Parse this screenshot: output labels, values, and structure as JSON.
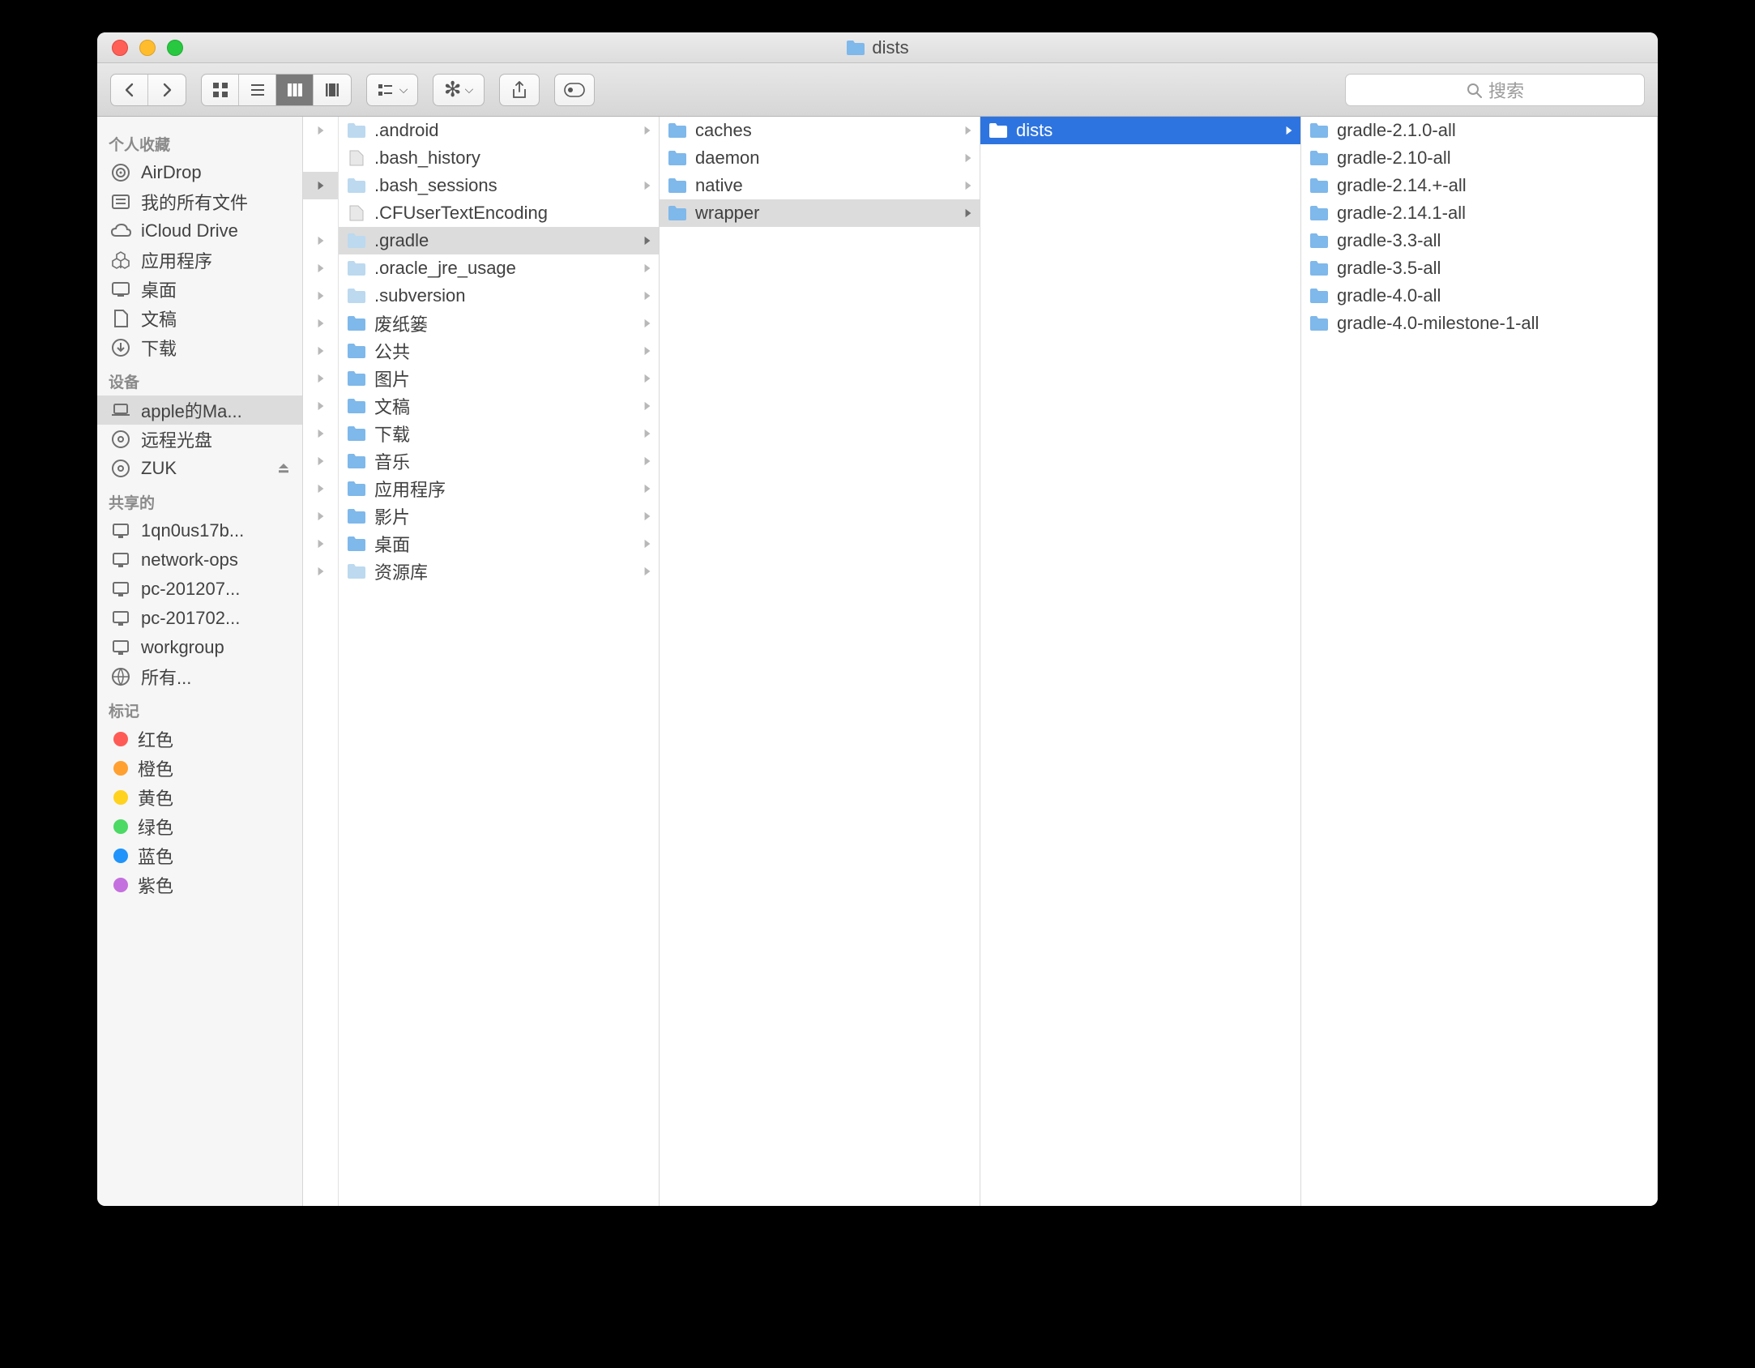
{
  "window": {
    "title": "dists"
  },
  "search": {
    "placeholder": "搜索"
  },
  "sidebar": {
    "sections": [
      {
        "heading": "个人收藏",
        "items": [
          {
            "icon": "airdrop",
            "label": "AirDrop"
          },
          {
            "icon": "allfiles",
            "label": "我的所有文件"
          },
          {
            "icon": "icloud",
            "label": "iCloud Drive"
          },
          {
            "icon": "apps",
            "label": "应用程序"
          },
          {
            "icon": "desktop",
            "label": "桌面"
          },
          {
            "icon": "docs",
            "label": "文稿"
          },
          {
            "icon": "downloads",
            "label": "下载"
          }
        ]
      },
      {
        "heading": "设备",
        "items": [
          {
            "icon": "laptop",
            "label": "apple的Ma...",
            "selected": true
          },
          {
            "icon": "disc",
            "label": "远程光盘"
          },
          {
            "icon": "disc",
            "label": "ZUK",
            "eject": true
          }
        ]
      },
      {
        "heading": "共享的",
        "items": [
          {
            "icon": "pc",
            "label": "1qn0us17b..."
          },
          {
            "icon": "pc",
            "label": "network-ops"
          },
          {
            "icon": "pc",
            "label": "pc-201207..."
          },
          {
            "icon": "pc",
            "label": "pc-201702..."
          },
          {
            "icon": "pc",
            "label": "workgroup"
          },
          {
            "icon": "globe",
            "label": "所有..."
          }
        ]
      },
      {
        "heading": "标记",
        "items": [
          {
            "tag": "#ff5b56",
            "label": "红色"
          },
          {
            "tag": "#ffa030",
            "label": "橙色"
          },
          {
            "tag": "#ffd21f",
            "label": "黄色"
          },
          {
            "tag": "#4cd964",
            "label": "绿色"
          },
          {
            "tag": "#2094fa",
            "label": "蓝色"
          },
          {
            "tag": "#c470de",
            "label": "紫色"
          }
        ]
      }
    ]
  },
  "columns": {
    "c0_selected_index": 2,
    "c1": [
      {
        "t": "folder-light",
        "label": ".android",
        "arrow": true
      },
      {
        "t": "file",
        "label": ".bash_history"
      },
      {
        "t": "folder-light",
        "label": ".bash_sessions",
        "arrow": true
      },
      {
        "t": "file",
        "label": ".CFUserTextEncoding"
      },
      {
        "t": "folder-light",
        "label": ".gradle",
        "arrow": true,
        "selected": "gray"
      },
      {
        "t": "folder-light",
        "label": ".oracle_jre_usage",
        "arrow": true
      },
      {
        "t": "folder-light",
        "label": ".subversion",
        "arrow": true
      },
      {
        "t": "folder",
        "label": "废纸篓",
        "arrow": true
      },
      {
        "t": "folder",
        "label": "公共",
        "arrow": true
      },
      {
        "t": "folder",
        "label": "图片",
        "arrow": true
      },
      {
        "t": "folder",
        "label": "文稿",
        "arrow": true
      },
      {
        "t": "folder",
        "label": "下载",
        "arrow": true
      },
      {
        "t": "folder",
        "label": "音乐",
        "arrow": true
      },
      {
        "t": "folder",
        "label": "应用程序",
        "arrow": true
      },
      {
        "t": "folder",
        "label": "影片",
        "arrow": true
      },
      {
        "t": "folder",
        "label": "桌面",
        "arrow": true
      },
      {
        "t": "folder-light",
        "label": "资源库",
        "arrow": true
      }
    ],
    "c2": [
      {
        "t": "folder",
        "label": "caches",
        "arrow": true
      },
      {
        "t": "folder",
        "label": "daemon",
        "arrow": true
      },
      {
        "t": "folder",
        "label": "native",
        "arrow": true
      },
      {
        "t": "folder",
        "label": "wrapper",
        "arrow": true,
        "selected": "gray"
      }
    ],
    "c3": [
      {
        "t": "folder",
        "label": "dists",
        "arrow": true,
        "selected": "blue"
      }
    ],
    "c4": [
      {
        "t": "folder",
        "label": "gradle-2.1.0-all"
      },
      {
        "t": "folder",
        "label": "gradle-2.10-all"
      },
      {
        "t": "folder",
        "label": "gradle-2.14.+-all"
      },
      {
        "t": "folder",
        "label": "gradle-2.14.1-all"
      },
      {
        "t": "folder",
        "label": "gradle-3.3-all"
      },
      {
        "t": "folder",
        "label": "gradle-3.5-all"
      },
      {
        "t": "folder",
        "label": "gradle-4.0-all"
      },
      {
        "t": "folder",
        "label": "gradle-4.0-milestone-1-all"
      }
    ]
  }
}
